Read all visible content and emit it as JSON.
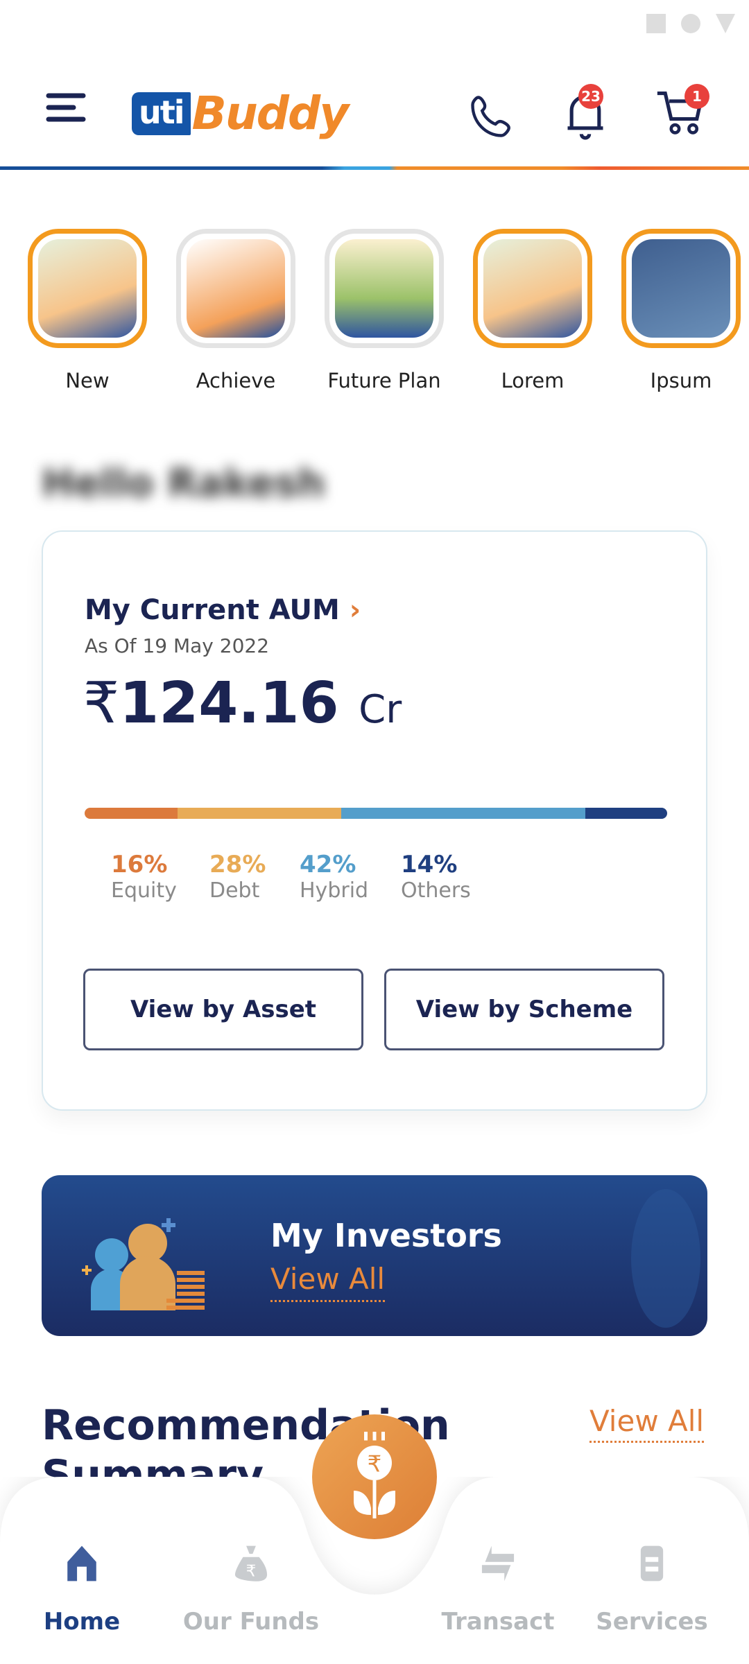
{
  "header": {
    "logo_uti": "uti",
    "logo_buddy": "Buddy",
    "notifications_count": "23",
    "cart_count": "1"
  },
  "stories": [
    {
      "label": "New",
      "seen": false
    },
    {
      "label": "Achieve",
      "seen": true
    },
    {
      "label": "Future Plan",
      "seen": true
    },
    {
      "label": "Lorem",
      "seen": false
    },
    {
      "label": "Ipsum",
      "seen": false
    }
  ],
  "greeting": "Hello Rakesh",
  "aum": {
    "title": "My Current AUM",
    "chevron": "›",
    "as_of": "As Of 19 May 2022",
    "currency": "₹",
    "amount": "124.16",
    "unit": "Cr",
    "allocation": [
      {
        "pct": "16%",
        "name": "Equity",
        "value": 16,
        "color": "#dc7a3c"
      },
      {
        "pct": "28%",
        "name": "Debt",
        "value": 28,
        "color": "#e8ab56"
      },
      {
        "pct": "42%",
        "name": "Hybrid",
        "value": 42,
        "color": "#549ecb"
      },
      {
        "pct": "14%",
        "name": "Others",
        "value": 14,
        "color": "#1f3f80"
      }
    ],
    "view_by_asset": "View by Asset",
    "view_by_scheme": "View by Scheme"
  },
  "investors": {
    "title": "My Investors",
    "view_all": "View All"
  },
  "recommendation": {
    "title": "Recommendation Summary",
    "view_all": "View All"
  },
  "nav": [
    {
      "label": "Home",
      "icon": "home-icon",
      "active": true
    },
    {
      "label": "Our Funds",
      "icon": "money-bag-icon",
      "active": false
    },
    {
      "label": "Transact",
      "icon": "transfer-icon",
      "active": false
    },
    {
      "label": "Services",
      "icon": "services-icon",
      "active": false
    }
  ],
  "fab_icon": "rupee-plant-icon"
}
